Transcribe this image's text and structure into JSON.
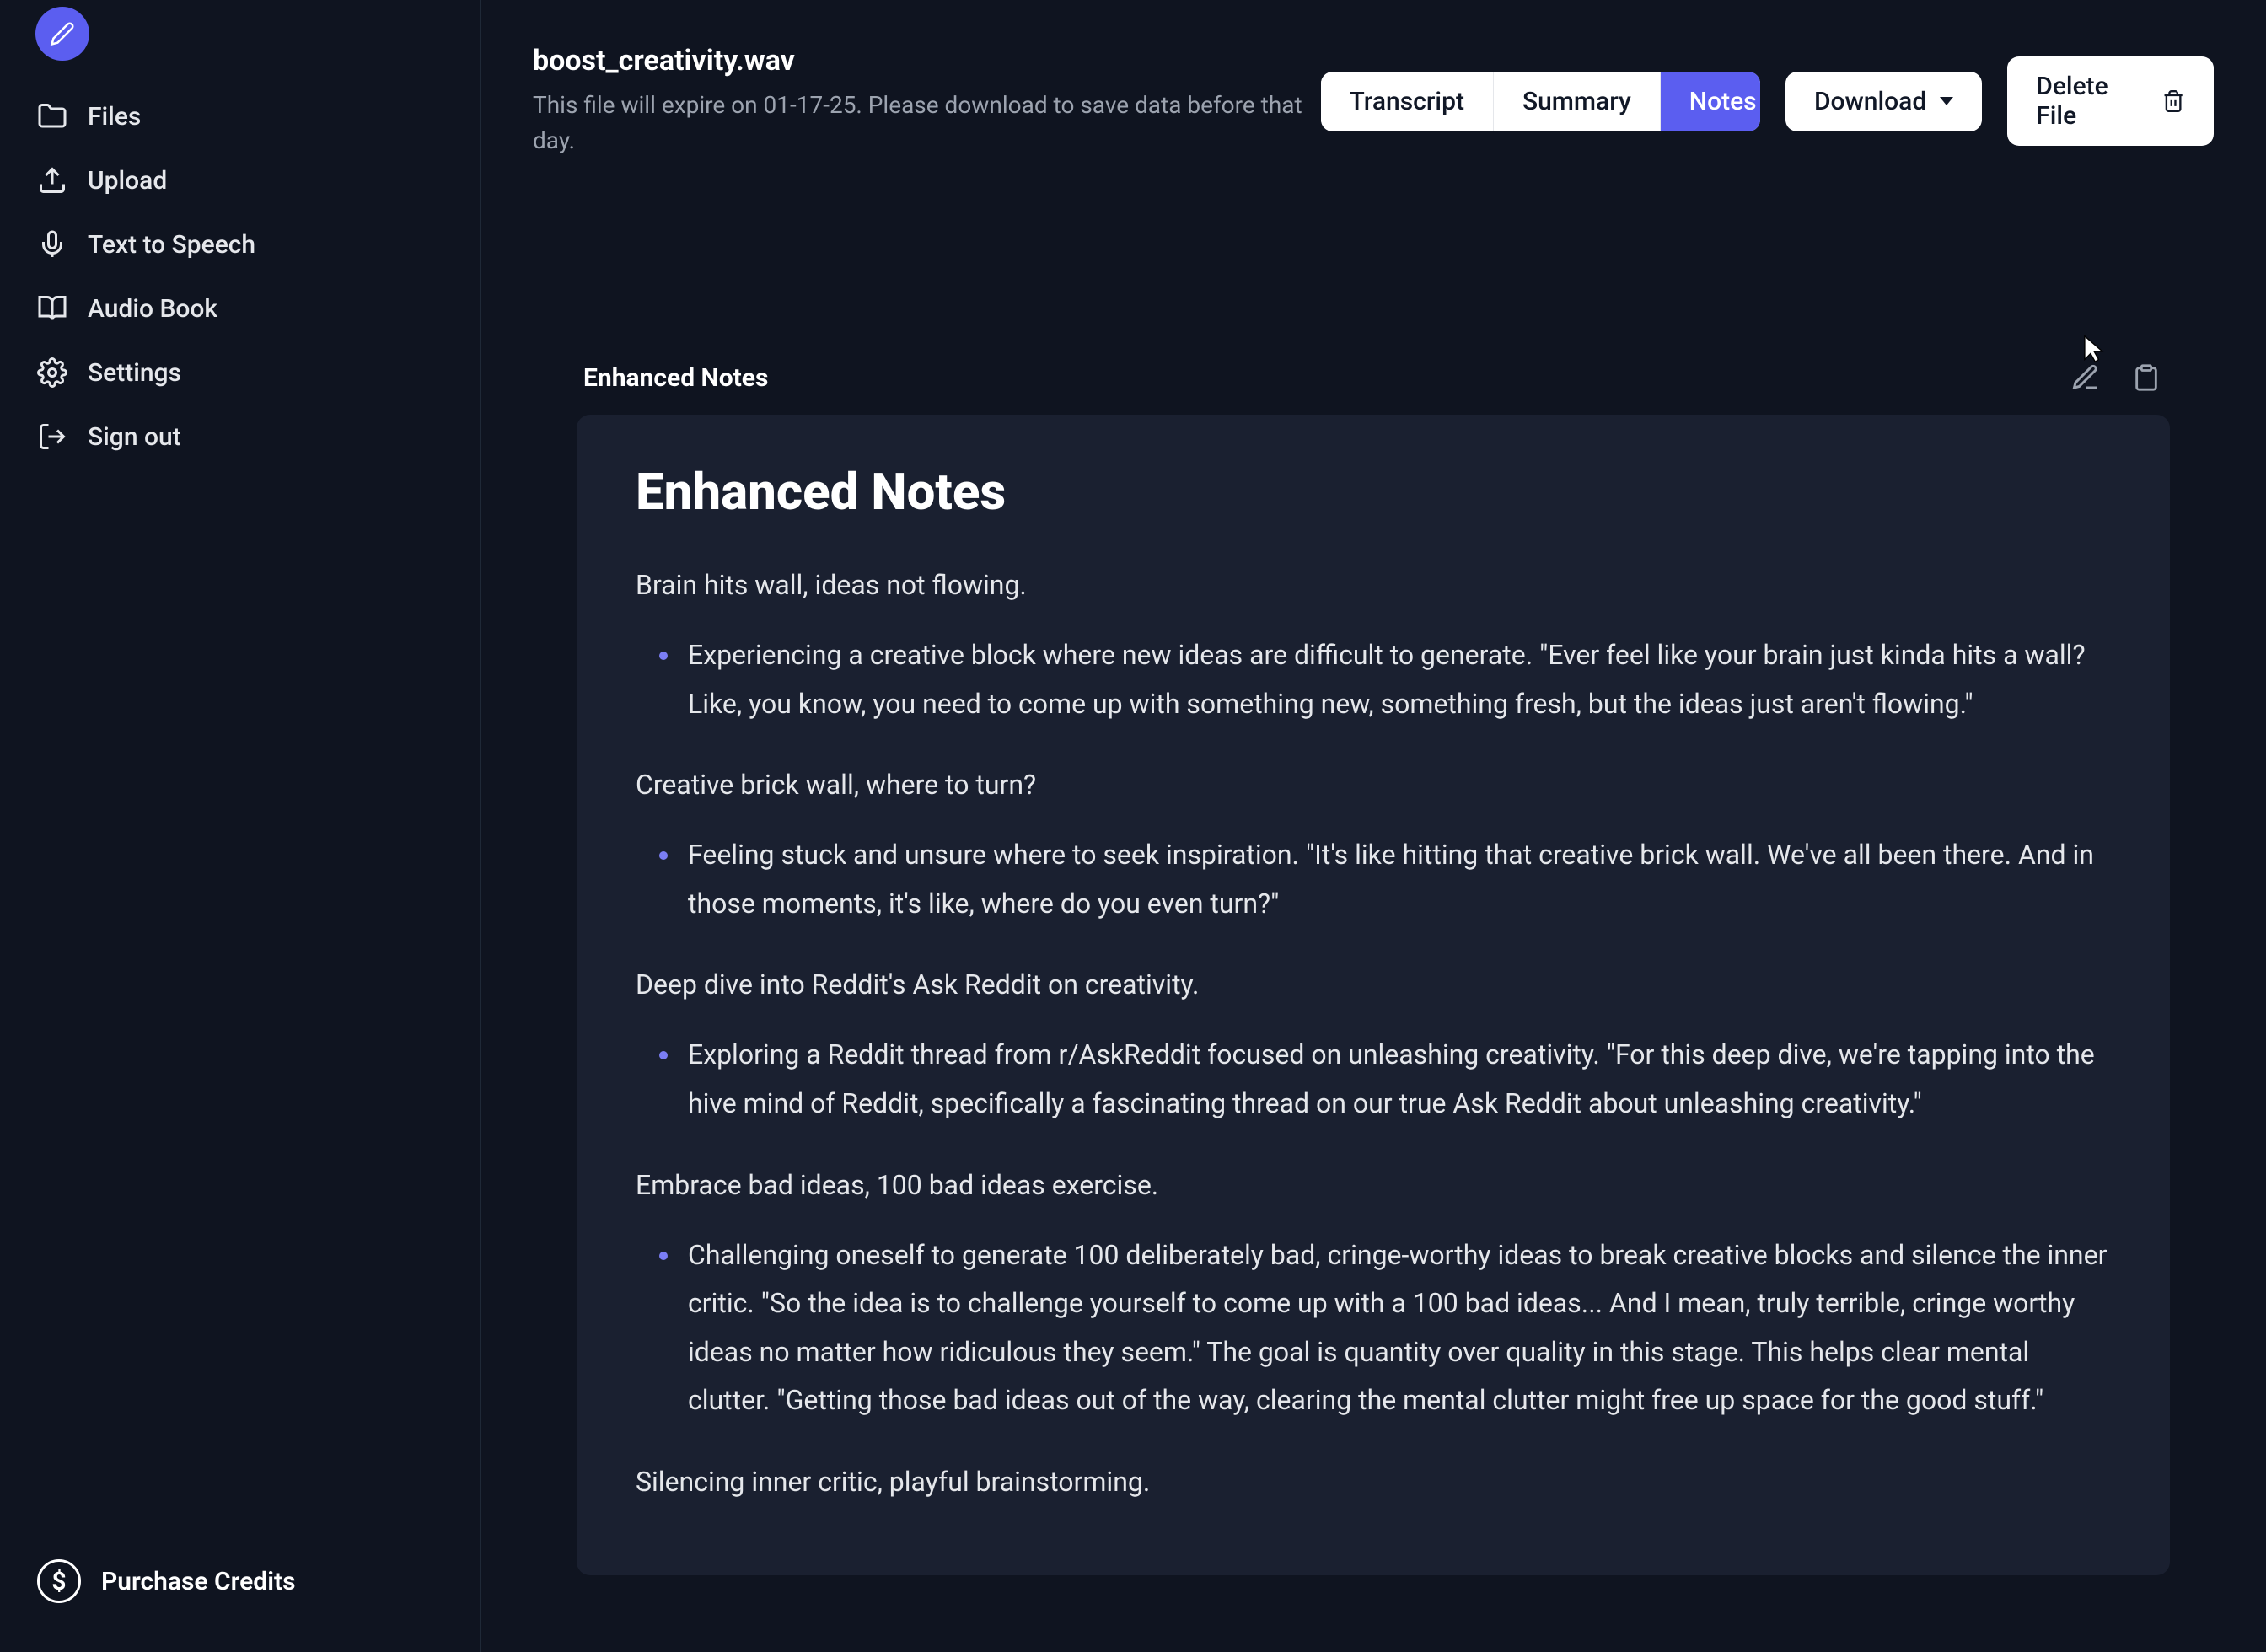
{
  "sidebar": {
    "items": [
      {
        "label": "Files",
        "icon": "folder-icon"
      },
      {
        "label": "Upload",
        "icon": "upload-icon"
      },
      {
        "label": "Text to Speech",
        "icon": "microphone-icon"
      },
      {
        "label": "Audio Book",
        "icon": "book-icon"
      },
      {
        "label": "Settings",
        "icon": "gear-icon"
      },
      {
        "label": "Sign out",
        "icon": "signout-icon"
      }
    ],
    "purchase_credits_label": "Purchase Credits"
  },
  "header": {
    "file_title": "boost_creativity.wav",
    "file_expire": "This file will expire on 01-17-25. Please download to save data before that day.",
    "tabs": [
      {
        "label": "Transcript",
        "active": false
      },
      {
        "label": "Summary",
        "active": false
      },
      {
        "label": "Notes",
        "active": true
      }
    ],
    "download_label": "Download",
    "delete_label": "Delete File"
  },
  "notes": {
    "section_label": "Enhanced Notes",
    "title": "Enhanced Notes",
    "blocks": [
      {
        "heading": "Brain hits wall, ideas not flowing.",
        "items": [
          "Experiencing a creative block where new ideas are difficult to generate. \"Ever feel like your brain just kinda hits a wall? Like, you know, you need to come up with something new, something fresh, but the ideas just aren't flowing.\""
        ]
      },
      {
        "heading": "Creative brick wall, where to turn?",
        "items": [
          "Feeling stuck and unsure where to seek inspiration. \"It's like hitting that creative brick wall. We've all been there. And in those moments, it's like, where do you even turn?\""
        ]
      },
      {
        "heading": "Deep dive into Reddit's Ask Reddit on creativity.",
        "items": [
          "Exploring a Reddit thread from r/AskReddit focused on unleashing creativity. \"For this deep dive, we're tapping into the hive mind of Reddit, specifically a fascinating thread on our true Ask Reddit about unleashing creativity.\""
        ]
      },
      {
        "heading": "Embrace bad ideas, 100 bad ideas exercise.",
        "items": [
          "Challenging oneself to generate 100 deliberately bad, cringe-worthy ideas to break creative blocks and silence the inner critic. \"So the idea is to challenge yourself to come up with a 100 bad ideas... And I mean, truly terrible, cringe worthy ideas no matter how ridiculous they seem.\" The goal is quantity over quality in this stage. This helps clear mental clutter. \"Getting those bad ideas out of the way, clearing the mental clutter might free up space for the good stuff.\""
        ]
      },
      {
        "heading": "Silencing inner critic, playful brainstorming.",
        "items": []
      }
    ]
  }
}
